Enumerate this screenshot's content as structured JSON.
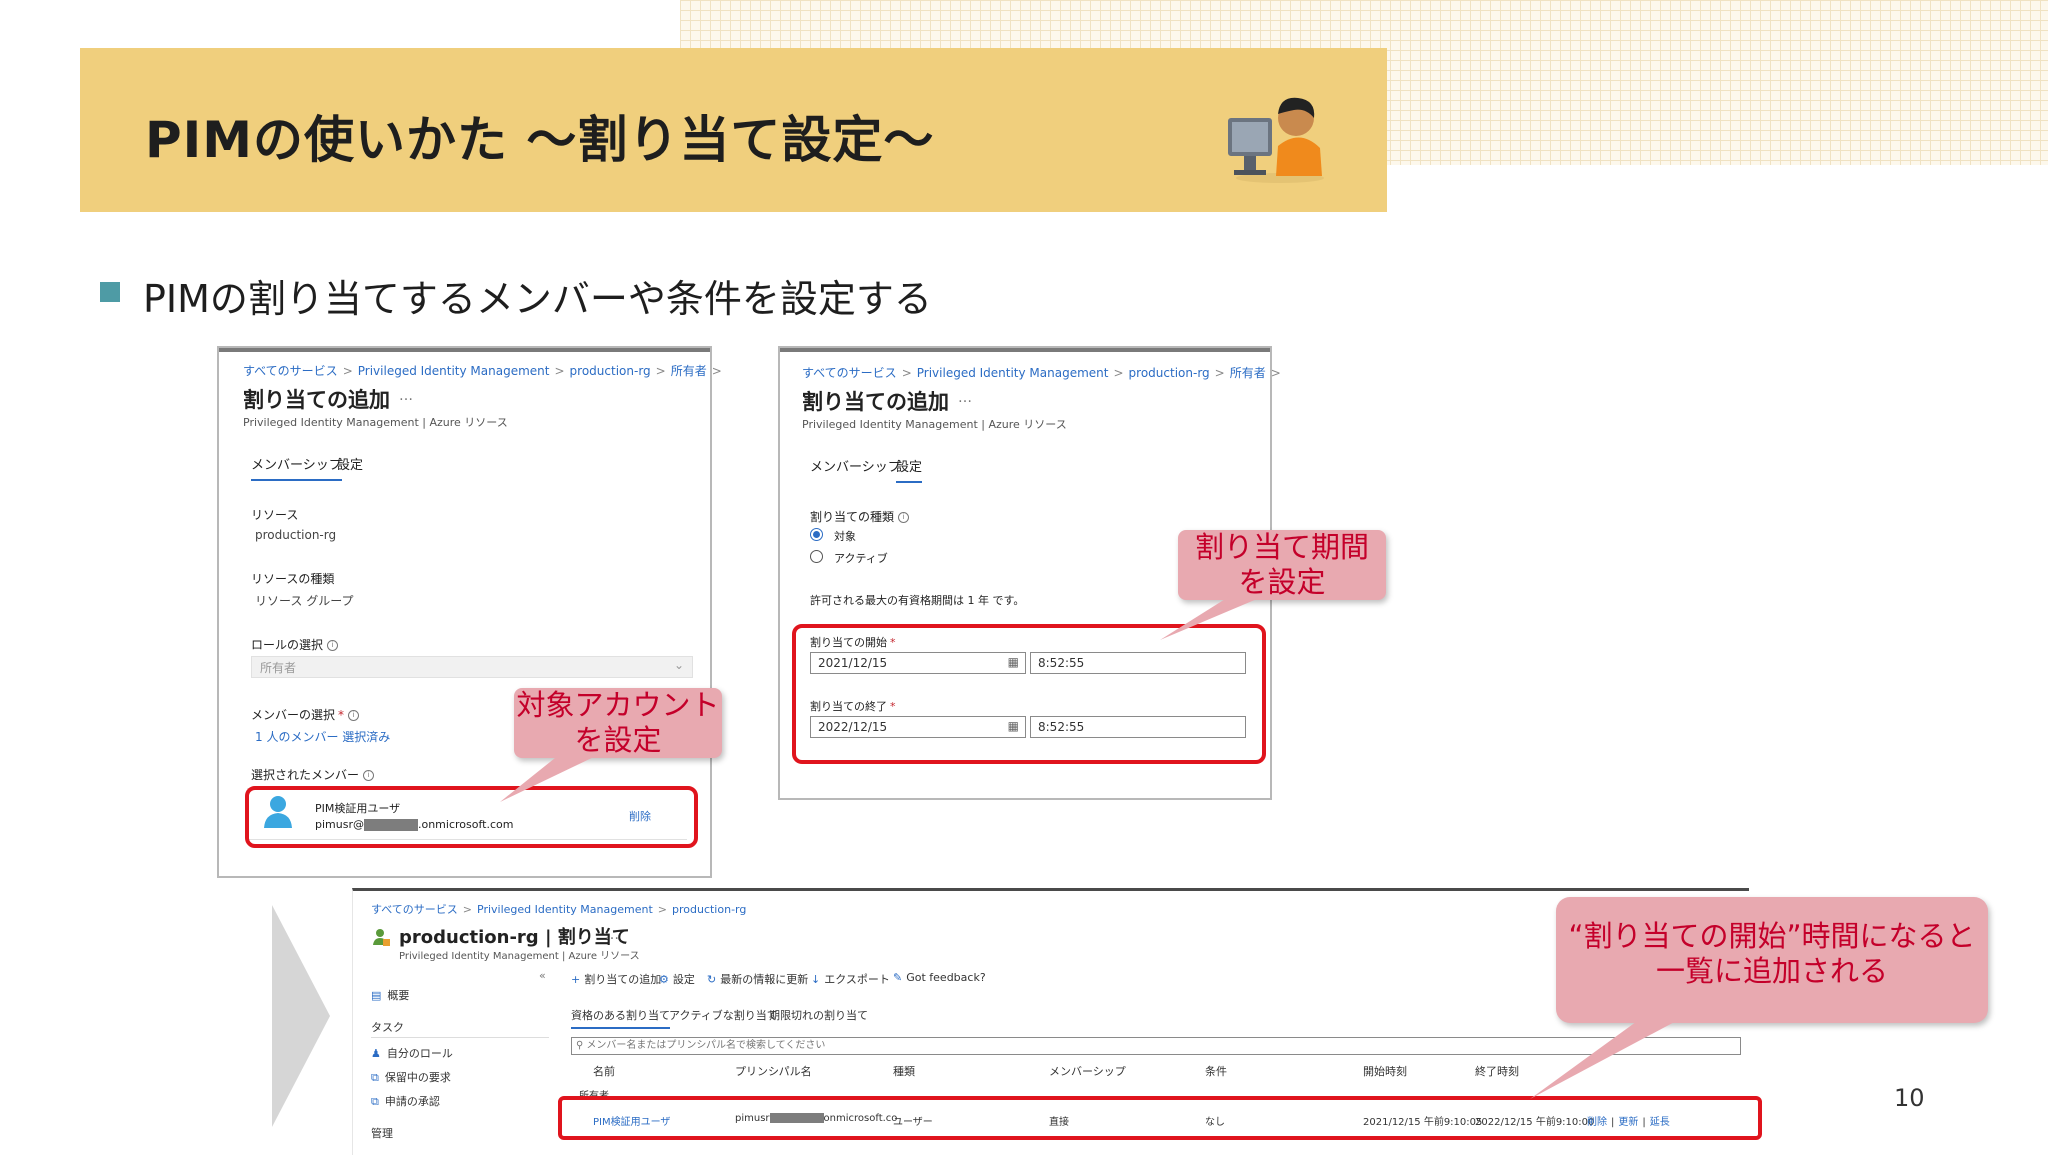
{
  "slide": {
    "title": "PIMの使いかた ～割り当て設定～",
    "bullet": "PIMの割り当てするメンバーや条件を設定する",
    "page_number": "10",
    "colors": {
      "title_band": "#f0cf7d",
      "bullet": "#4e9ba5",
      "highlight_red": "#e0141d",
      "callout_bg": "#e8a9b0",
      "callout_text": "#c4002a"
    },
    "icon": "user-at-computer-icon"
  },
  "panel1": {
    "breadcrumb": [
      "すべてのサービス",
      "Privileged Identity Management",
      "production-rg",
      "所有者"
    ],
    "title": "割り当ての追加",
    "more": "…",
    "subtitle": "Privileged Identity Management | Azure リソース",
    "tabs": [
      "メンバーシップ",
      "設定"
    ],
    "resource_label": "リソース",
    "resource_value": "production-rg",
    "resource_type_label": "リソースの種類",
    "resource_type_value": "リソース グループ",
    "role_label": "ロールの選択",
    "role_value": "所有者",
    "member_label": "メンバーの選択",
    "member_required": "*",
    "member_link": "1 人のメンバー 選択済み",
    "selected_label": "選択されたメンバー",
    "user_name": "PIM検証用ユーザ",
    "user_email_prefix": "pimusr@",
    "user_email_suffix": ".onmicrosoft.com",
    "remove_link": "削除"
  },
  "panel2": {
    "breadcrumb": [
      "すべてのサービス",
      "Privileged Identity Management",
      "production-rg",
      "所有者"
    ],
    "title": "割り当ての追加",
    "more": "…",
    "subtitle": "Privileged Identity Management | Azure リソース",
    "tabs": [
      "メンバーシップ",
      "設定"
    ],
    "assign_type_label": "割り当ての種類",
    "radio_eligible": "対象",
    "radio_active": "アクティブ",
    "max_text": "許可される最大の有資格期間は 1 年 です。",
    "start_label": "割り当ての開始",
    "start_date": "2021/12/15",
    "start_time": "8:52:55",
    "end_label": "割り当ての終了",
    "end_date": "2022/12/15",
    "end_time": "8:52:55",
    "required": "*"
  },
  "panel3": {
    "breadcrumb": [
      "すべてのサービス",
      "Privileged Identity Management",
      "production-rg"
    ],
    "title": "production-rg | 割り当て",
    "more": "…",
    "subtitle": "Privileged Identity Management | Azure リソース",
    "collapse": "«",
    "sidebar": {
      "overview": "概要",
      "tasks": "タスク",
      "my_roles": "自分のロール",
      "pending": "保留中の要求",
      "approve": "申請の承認",
      "manage": "管理"
    },
    "toolbar": [
      "割り当ての追加",
      "設定",
      "最新の情報に更新",
      "エクスポート",
      "Got feedback?"
    ],
    "tabs": [
      "資格のある割り当て",
      "アクティブな割り当て",
      "期限切れの割り当て"
    ],
    "search_placeholder": "メンバー名またはプリンシパル名で検索してください",
    "columns": [
      "名前",
      "プリンシパル名",
      "種類",
      "メンバーシップ",
      "条件",
      "開始時刻",
      "終了時刻"
    ],
    "group_label": "所有者",
    "row": {
      "name": "PIM検証用ユーザ",
      "principal_prefix": "pimusr",
      "principal_suffix": "onmicrosoft.co",
      "type": "ユーザー",
      "membership": "直接",
      "condition": "なし",
      "start": "2021/12/15 午前9:10:05",
      "end": "2022/12/15 午前9:10:00",
      "actions": [
        "削除",
        "更新",
        "延長"
      ]
    }
  },
  "callouts": {
    "account": [
      "対象アカウント",
      "を設定"
    ],
    "period": [
      "割り当て期間",
      "を設定"
    ],
    "list": [
      "“割り当ての開始”時間になると",
      "一覧に追加される"
    ]
  }
}
